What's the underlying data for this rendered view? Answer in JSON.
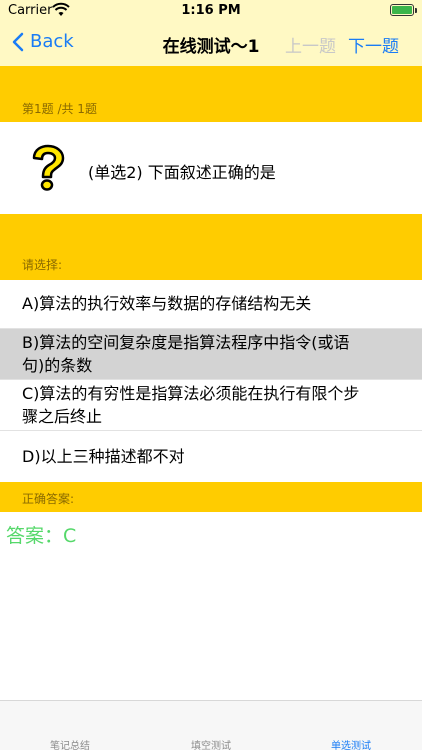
{
  "status_bar": {
    "carrier": "Carrier",
    "time": "1:16 PM"
  },
  "nav": {
    "back_label": "Back",
    "title": "在线测试～1",
    "prev_label": "上一题",
    "next_label": "下一题"
  },
  "question": {
    "progress": "第1题 /共 1题",
    "icon": "question-mark-icon",
    "text": "(单选2) 下面叙述正确的是"
  },
  "options_header": "请选择:",
  "options": [
    {
      "line1": "A)算法的执行效率与数据的存储结构无关",
      "line2": ""
    },
    {
      "line1": "B)算法的空间复杂度是指算法程序中指令(或语",
      "line2": "句)的条数"
    },
    {
      "line1": "C)算法的有穷性是指算法必须能在执行有限个步",
      "line2": "骤之后终止"
    },
    {
      "line1": "D)以上三种描述都不对",
      "line2": ""
    }
  ],
  "answer_header": "正确答案:",
  "answer": "答案：C",
  "tabs": [
    {
      "label": "笔记总结"
    },
    {
      "label": "填空测试"
    },
    {
      "label": "单选测试"
    }
  ],
  "colors": {
    "accent": "#1a7cf5",
    "band": "#ffcc00",
    "nav_bg": "#fff9c4",
    "answer": "#55d86a",
    "selected": "#d3d3d3"
  }
}
